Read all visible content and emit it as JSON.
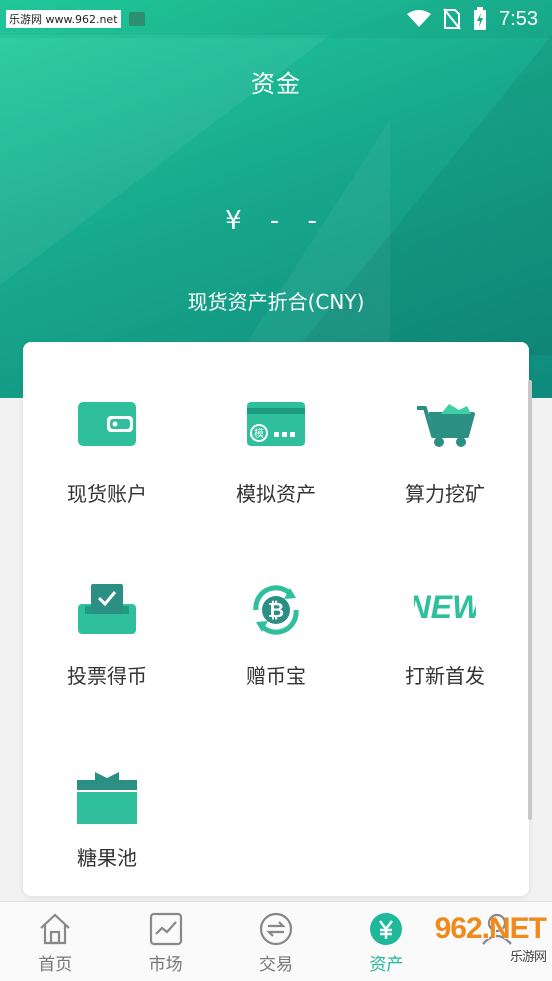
{
  "status_bar": {
    "site_watermark": "乐游网 www.962.net",
    "time": "7:53"
  },
  "header": {
    "title": "资金",
    "balance": "¥ - -",
    "balance_label": "现货资产折合(CNY)"
  },
  "grid": {
    "items": [
      {
        "label": "现货账户",
        "icon": "wallet-icon"
      },
      {
        "label": "模拟资产",
        "icon": "simulated-card-icon"
      },
      {
        "label": "算力挖矿",
        "icon": "mining-cart-icon"
      },
      {
        "label": "投票得币",
        "icon": "vote-box-icon"
      },
      {
        "label": "赠币宝",
        "icon": "bitcoin-cycle-icon"
      },
      {
        "label": "打新首发",
        "icon": "new-badge-icon"
      },
      {
        "label": "糖果池",
        "icon": "gift-box-icon"
      }
    ]
  },
  "tabbar": {
    "tabs": [
      {
        "label": "首页",
        "icon": "home-icon"
      },
      {
        "label": "市场",
        "icon": "chart-icon"
      },
      {
        "label": "交易",
        "icon": "exchange-icon"
      },
      {
        "label": "资产",
        "icon": "yuan-icon",
        "active": true
      },
      {
        "label": "",
        "icon": "profile-icon"
      }
    ]
  },
  "watermark": {
    "brand": "962.NET",
    "sub": "乐游网"
  },
  "colors": {
    "accent": "#1fb89a",
    "icon_teal": "#2fbf9d"
  }
}
